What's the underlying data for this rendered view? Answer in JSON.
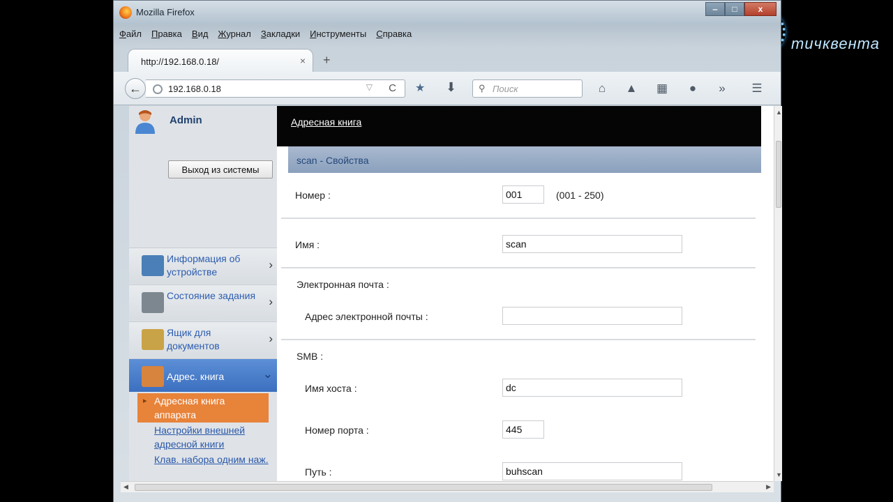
{
  "window": {
    "title": "Mozilla Firefox",
    "min": "‒",
    "max": "□",
    "close": "x"
  },
  "menubar": [
    "Файл",
    "Правка",
    "Вид",
    "Журнал",
    "Закладки",
    "Инструменты",
    "Справка"
  ],
  "tab": {
    "title": "http://192.168.0.18/",
    "close": "×",
    "new_tab": "+"
  },
  "toolbar": {
    "back": "←",
    "url": "192.168.0.18",
    "url_drop": "▽",
    "reload": "C",
    "search_placeholder": "Поиск",
    "icons": [
      "bookmark-icon",
      "download-icon",
      "home-icon",
      "pocket-icon",
      "screenshot-icon",
      "sync-icon",
      "overflow-icon",
      "menu-icon"
    ]
  },
  "sidebar": {
    "user": "Admin",
    "logout": "Выход из системы",
    "items": [
      {
        "label": "Информация об устройстве",
        "chevron": "›",
        "color": "#4a7fb8"
      },
      {
        "label": "Состояние задания",
        "chevron": "›",
        "color": "#7d8790"
      },
      {
        "label": "Ящик для документов",
        "chevron": "›",
        "color": "#c9a347"
      },
      {
        "label": "Адрес. книга",
        "chevron": "⌄",
        "color": "#d7843f",
        "active": true
      }
    ],
    "subitems": [
      {
        "label": "Адресная книга аппарата",
        "current": true
      },
      {
        "label": "Настройки внешней адресной книги"
      },
      {
        "label": "Клав. набора одним наж."
      }
    ]
  },
  "main": {
    "breadcrumb": "Адресная книга",
    "panel_title": "scan - Свойства",
    "number": {
      "label": "Номер :",
      "value": "001",
      "hint": "(001 - 250)"
    },
    "name": {
      "label": "Имя :",
      "value": "scan"
    },
    "email_section": "Электронная почта :",
    "email": {
      "label": "Адрес электронной почты :",
      "value": ""
    },
    "smb_section": "SMB :",
    "host": {
      "label": "Имя хоста :",
      "value": "dc"
    },
    "port": {
      "label": "Номер порта :",
      "value": "445"
    },
    "path": {
      "label": "Путь :",
      "value": "buhscan"
    }
  },
  "watermark": {
    "text": "тичквента"
  }
}
